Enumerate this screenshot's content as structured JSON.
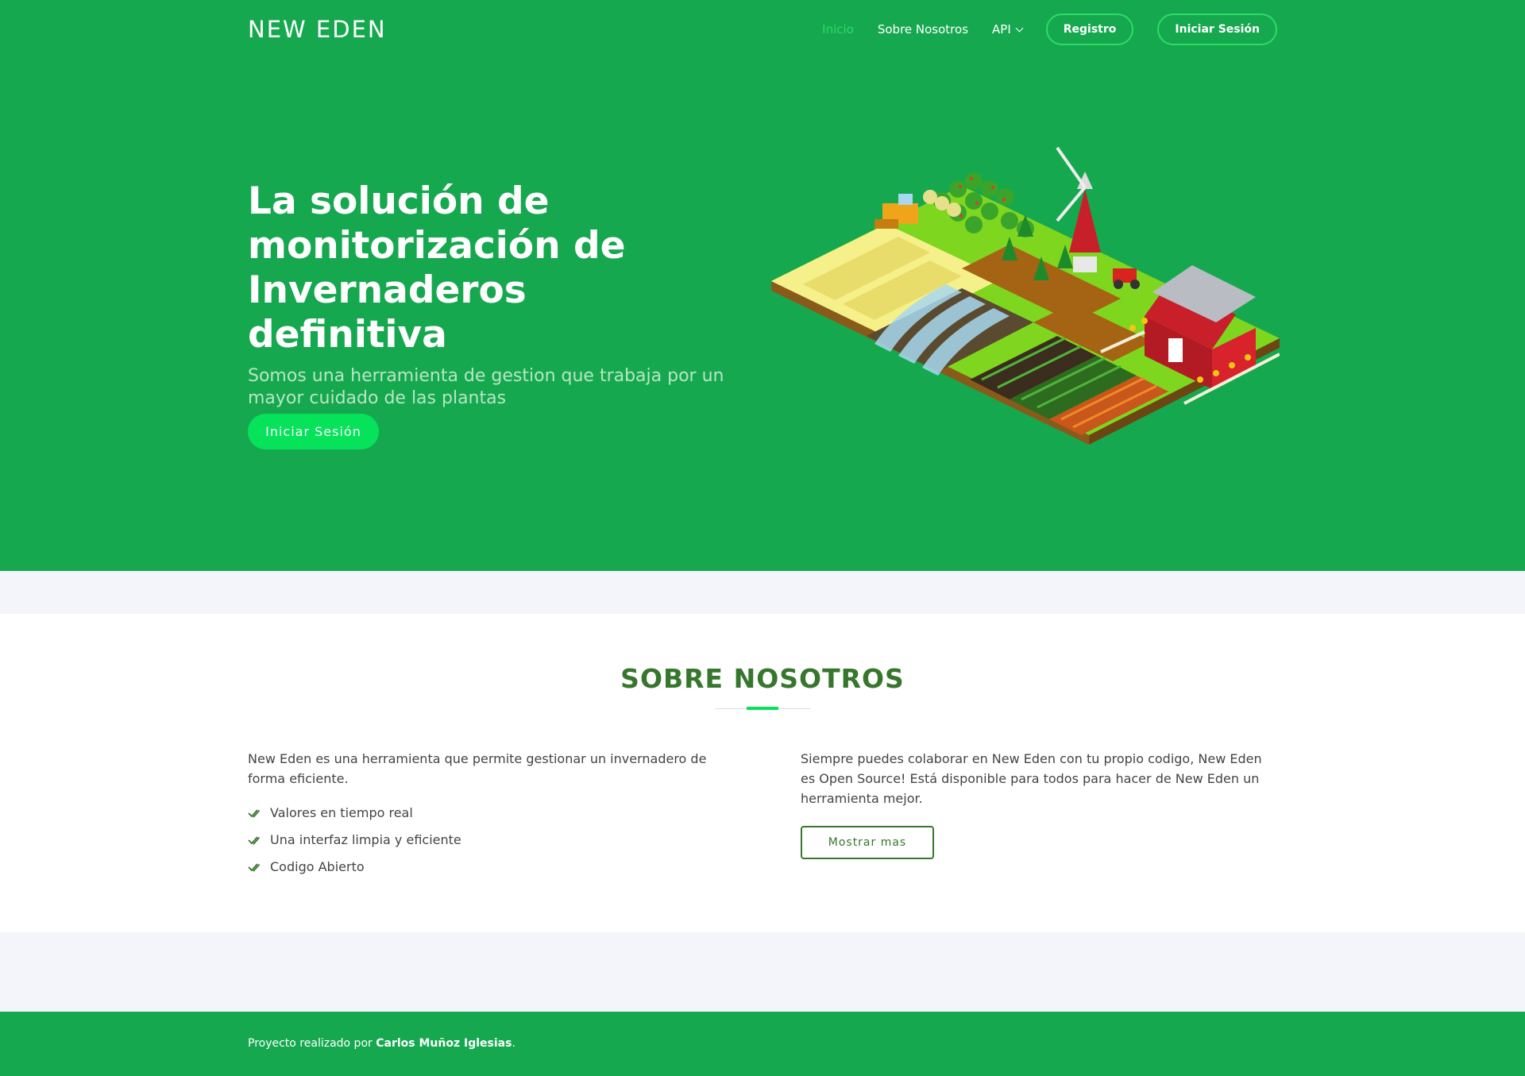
{
  "brand": {
    "logo": "NEW EDEN"
  },
  "nav": {
    "inicio": "Inicio",
    "sobre": "Sobre Nosotros",
    "api": "API",
    "registro": "Registro",
    "login": "Iniciar Sesión"
  },
  "hero": {
    "title": "La solución de monitorización de Invernaderos definitiva",
    "subtitle": "Somos una herramienta de gestion que trabaja por un mayor cuidado de las plantas",
    "cta": "Iniciar Sesión"
  },
  "about": {
    "title": "SOBRE NOSOTROS",
    "left_text": "New Eden es una herramienta que permite gestionar un invernadero de forma eficiente.",
    "features": [
      "Valores en tiempo real",
      "Una interfaz limpia y eficiente",
      "Codigo Abierto"
    ],
    "right_text": "Siempre puedes colaborar en New Eden con tu propio codigo, New Eden es Open Source! Está disponible para todos para hacer de New Eden un herramienta mejor.",
    "more_button": "Mostrar mas"
  },
  "footer": {
    "prefix": "Proyecto realizado por",
    "author": "Carlos Muñoz Iglesias",
    "suffix": "."
  },
  "colors": {
    "hero_bg": "#16a84f",
    "accent": "#06e35a",
    "title_green": "#37762d",
    "band_bg": "#f3f5fa"
  }
}
